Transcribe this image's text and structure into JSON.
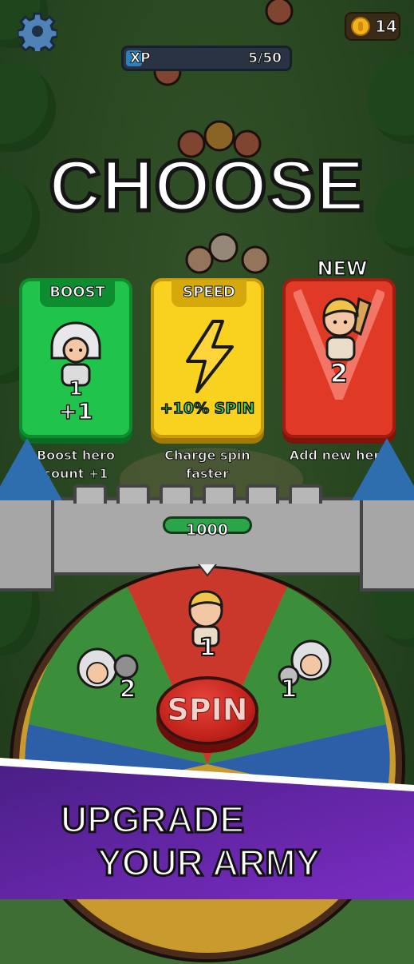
{
  "hud": {
    "xp_label": "XP",
    "xp_value": "5/50",
    "xp_progress": 0.1,
    "coins": "14"
  },
  "title": "CHOOSE",
  "cards": [
    {
      "ribbon": "BOOST",
      "count": "1",
      "bonus": "+1",
      "caption_line1": "Boost hero",
      "caption_line2": "count +1",
      "color": "#20c44b"
    },
    {
      "ribbon": "SPEED",
      "bonus": "+10% SPIN",
      "caption_line1": "Charge spin",
      "caption_line2": "faster",
      "color": "#f9d220"
    },
    {
      "ribbon": "NEW",
      "count": "2",
      "caption_line1": "Add new hero",
      "color": "#e03a27"
    }
  ],
  "castle": {
    "hp": "1000"
  },
  "wheel": {
    "spin_label": "SPIN",
    "segments": [
      {
        "hero": "swordsman",
        "count": "1"
      },
      {
        "hero": "knight",
        "count": "2"
      },
      {
        "hero": "knight",
        "count": "1"
      }
    ]
  },
  "banner": {
    "line1": "UPGRADE",
    "line2": "YOUR ARMY"
  }
}
